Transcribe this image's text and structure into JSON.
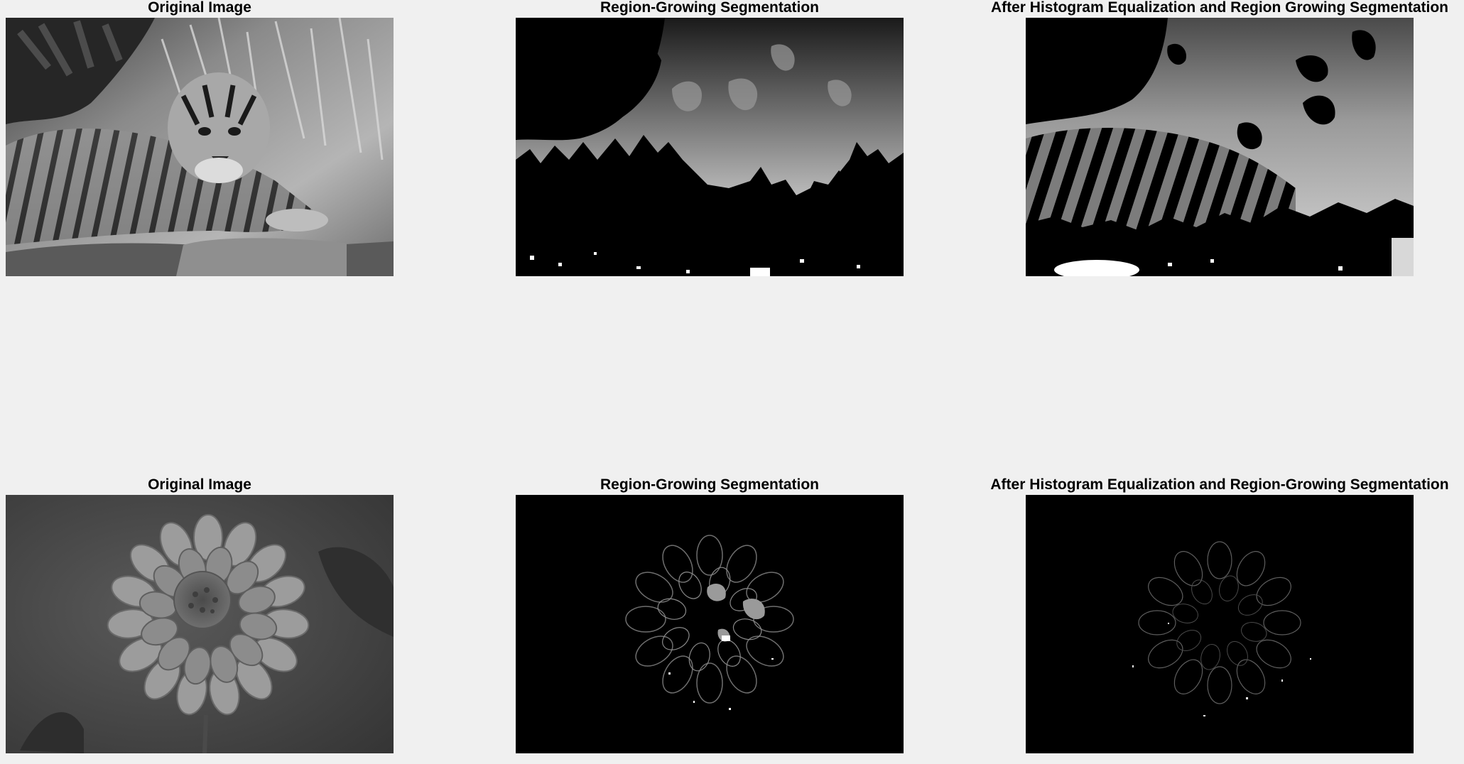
{
  "figure": {
    "rows": [
      {
        "panels": [
          {
            "title": "Original Image",
            "subject": "tiger-grayscale-photo"
          },
          {
            "title": "Region-Growing Segmentation",
            "subject": "tiger-region-growing-result"
          },
          {
            "title": "After Histogram Equalization and Region Growing Segmentation",
            "subject": "tiger-equalized-region-growing-result"
          }
        ]
      },
      {
        "panels": [
          {
            "title": "Original Image",
            "subject": "dahlia-grayscale-photo"
          },
          {
            "title": "Region-Growing Segmentation",
            "subject": "dahlia-region-growing-result"
          },
          {
            "title": "After Histogram Equalization and Region-Growing Segmentation",
            "subject": "dahlia-equalized-region-growing-result"
          }
        ]
      }
    ],
    "background_color": "#f0f0f0"
  }
}
